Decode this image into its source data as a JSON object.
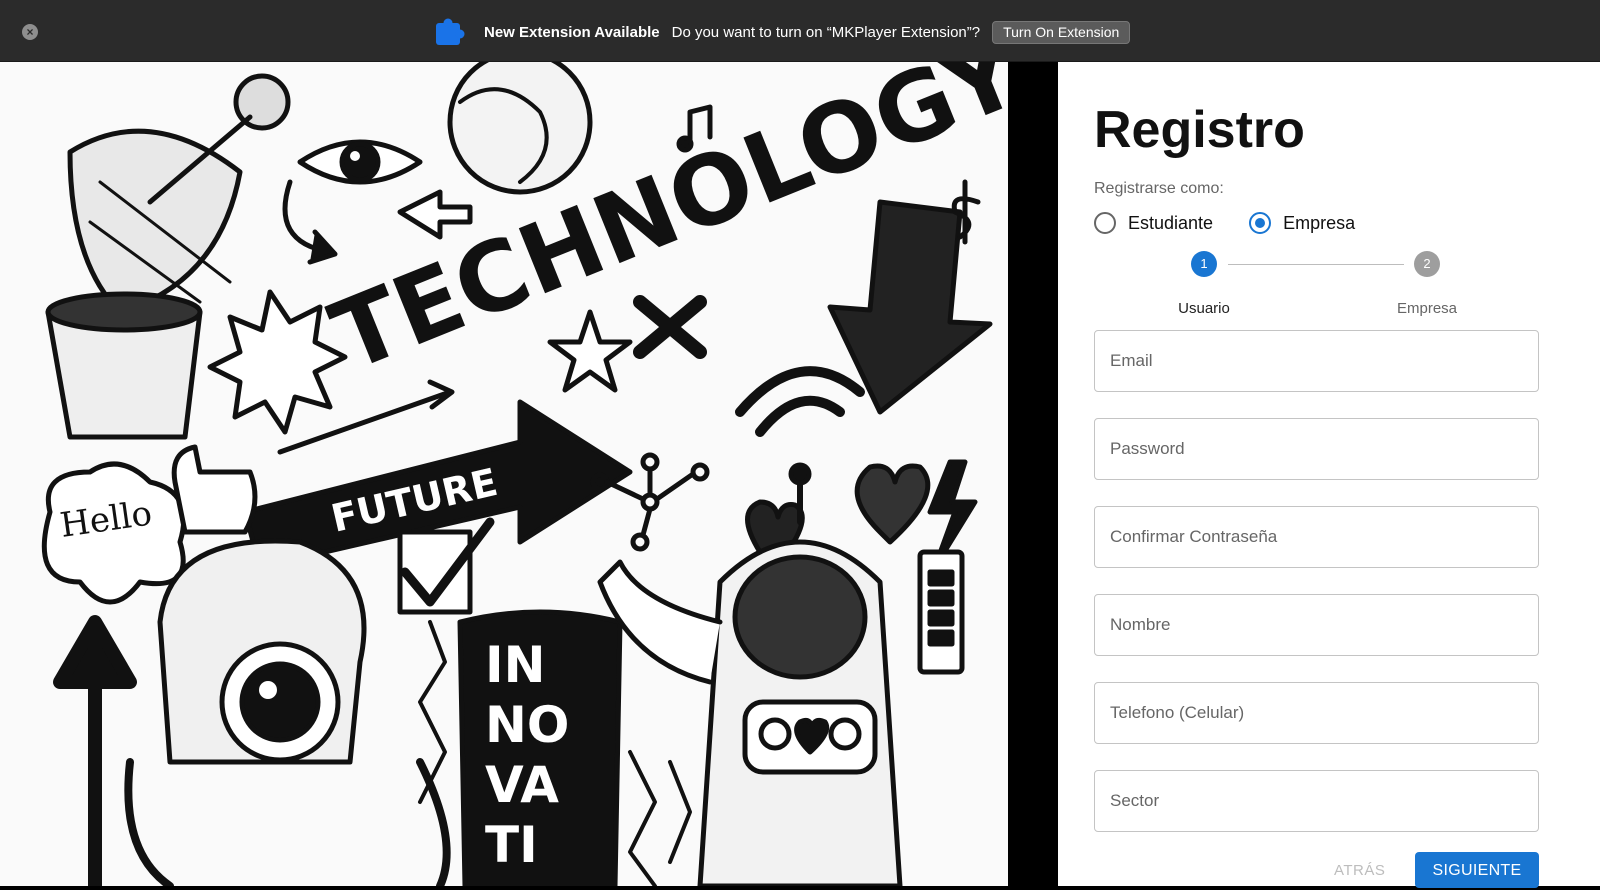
{
  "banner": {
    "title": "New Extension Available",
    "message": "Do you want to turn on “MKPlayer Extension”?",
    "button": "Turn On Extension",
    "close_symbol": "×"
  },
  "artwork": {
    "words": [
      "TECHNOLOGY",
      "FUTURE",
      "Hello",
      "IN",
      "NO",
      "VA",
      "TI"
    ]
  },
  "form": {
    "title": "Registro",
    "register_as_label": "Registrarse como:",
    "roles": [
      {
        "label": "Estudiante",
        "selected": false
      },
      {
        "label": "Empresa",
        "selected": true
      }
    ],
    "steps": [
      {
        "number": "1",
        "label": "Usuario",
        "active": true
      },
      {
        "number": "2",
        "label": "Empresa",
        "active": false
      }
    ],
    "fields": [
      {
        "placeholder": "Email",
        "value": ""
      },
      {
        "placeholder": "Password",
        "value": ""
      },
      {
        "placeholder": "Confirmar Contraseña",
        "value": ""
      },
      {
        "placeholder": "Nombre",
        "value": ""
      },
      {
        "placeholder": "Telefono (Celular)",
        "value": ""
      },
      {
        "placeholder": "Sector",
        "value": ""
      }
    ],
    "back_button": "ATRÁS",
    "next_button": "SIGUIENTE"
  },
  "colors": {
    "primary": "#1976d2",
    "inactive_step": "#9e9e9e",
    "banner_bg": "#2b2b2b"
  }
}
